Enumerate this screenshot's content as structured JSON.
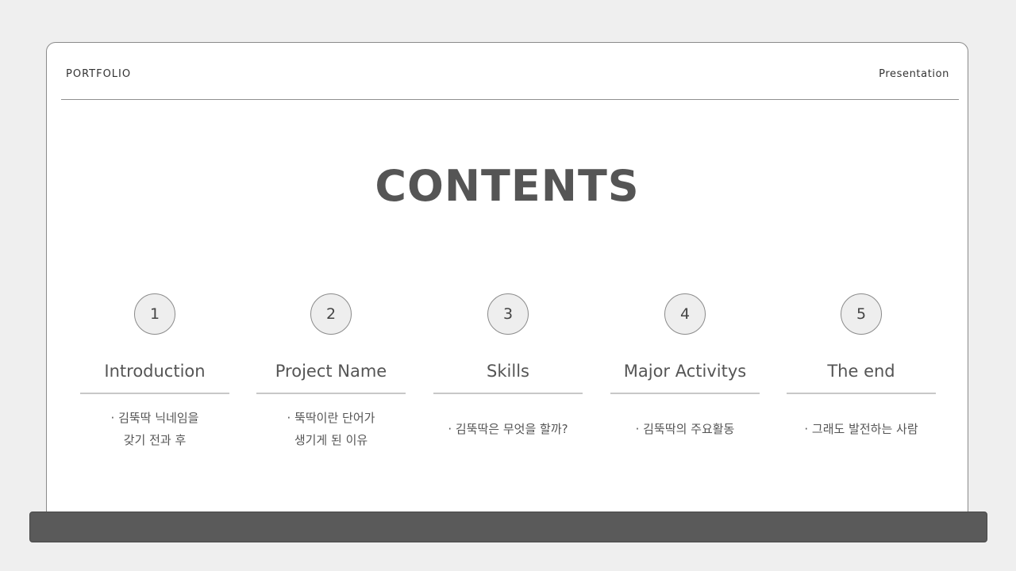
{
  "header": {
    "brand": "PORTFOLIO",
    "right_label": "Presentation"
  },
  "title": "CONTENTS",
  "sections": [
    {
      "number": "1",
      "title": "Introduction",
      "desc": "·  김뚝딱 닉네임을\n갖기 전과 후"
    },
    {
      "number": "2",
      "title": "Project Name",
      "desc": "·  뚝딱이란 단어가\n생기게 된 이유"
    },
    {
      "number": "3",
      "title": "Skills",
      "desc": "·  김뚝딱은 무엇을 할까?"
    },
    {
      "number": "4",
      "title": "Major Activitys",
      "desc": "·  김뚝딱의 주요활동"
    },
    {
      "number": "5",
      "title": "The end",
      "desc": "· 그래도 발전하는 사람"
    }
  ],
  "colors": {
    "background": "#efefef",
    "card": "#ffffff",
    "text": "#555555",
    "bottom_bar": "#5a5a5a",
    "circle_fill": "#eeeeee"
  }
}
